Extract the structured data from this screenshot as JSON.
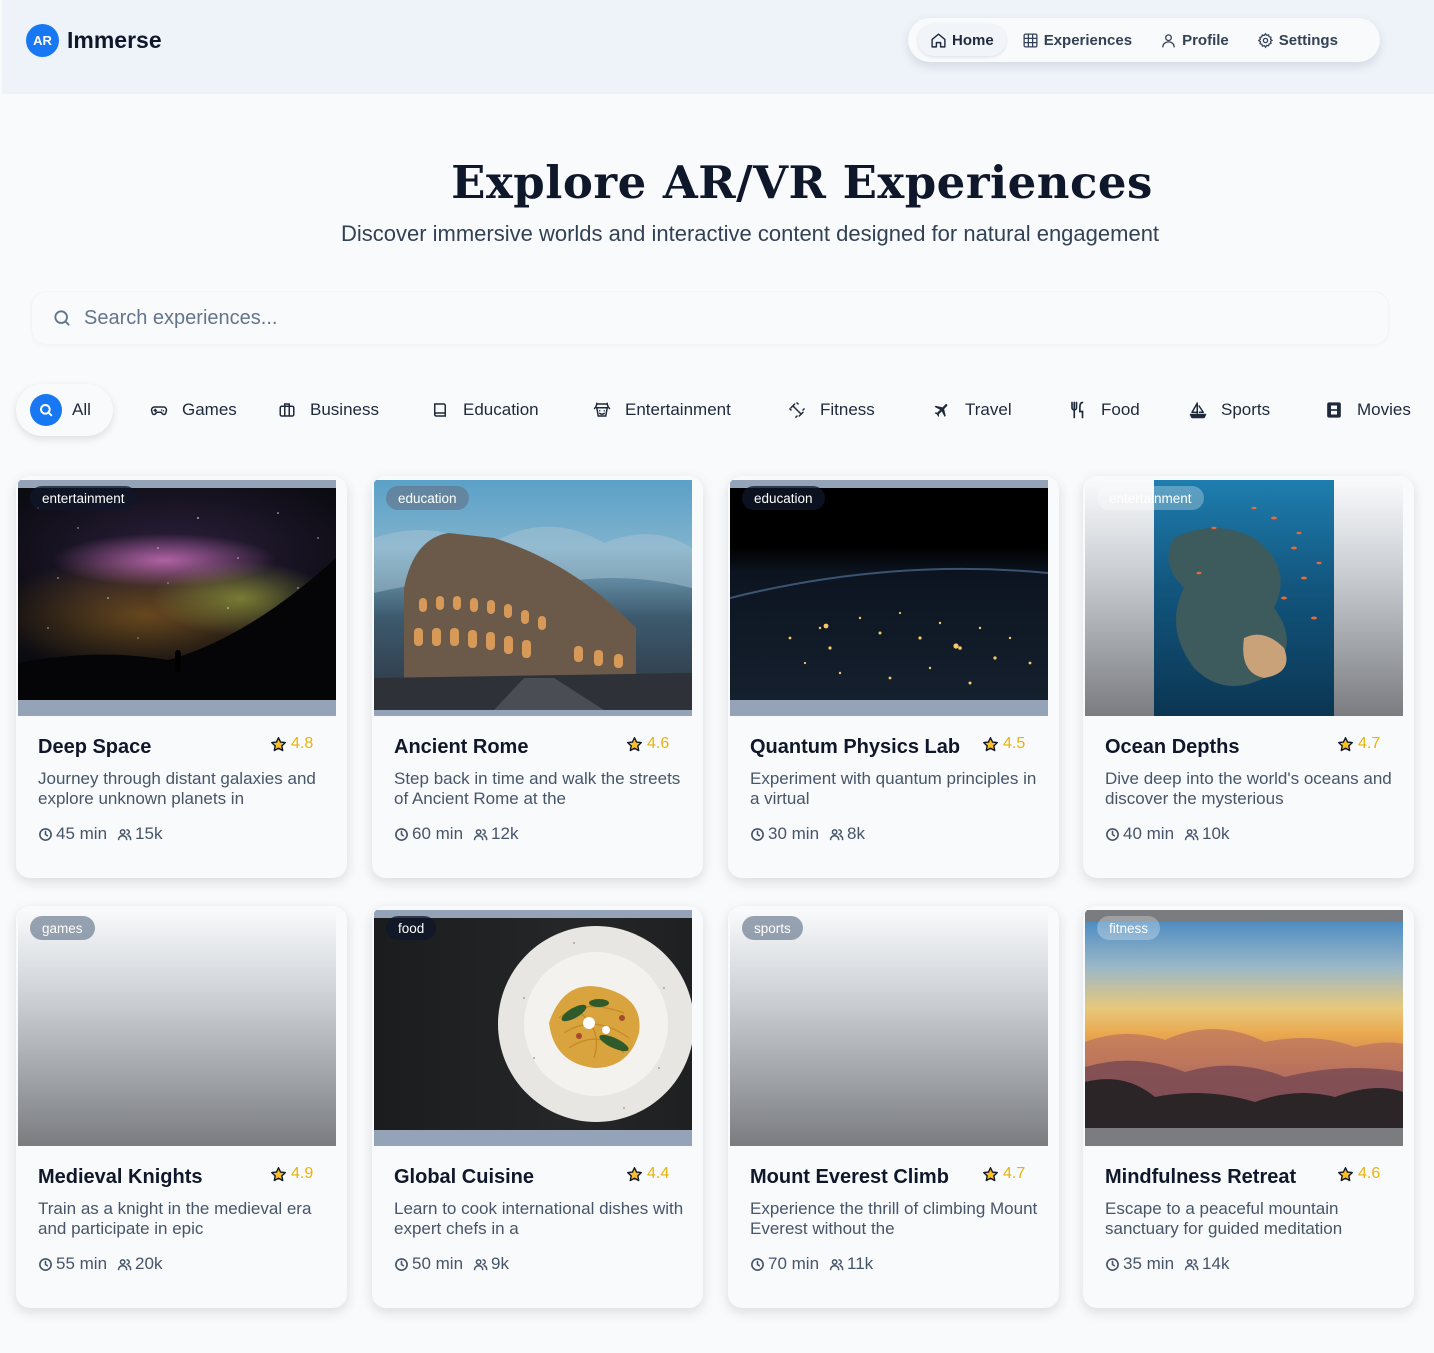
{
  "brand": {
    "logo": "AR",
    "name": "Immerse"
  },
  "nav": [
    {
      "label": "Home",
      "icon": "home-icon",
      "active": true
    },
    {
      "label": "Experiences",
      "icon": "grid-icon",
      "active": false
    },
    {
      "label": "Profile",
      "icon": "user-icon",
      "active": false
    },
    {
      "label": "Settings",
      "icon": "gear-icon",
      "active": false
    }
  ],
  "hero": {
    "title": "Explore AR/VR Experiences",
    "subtitle": "Discover immersive worlds and interactive content designed for natural engagement"
  },
  "search": {
    "placeholder": "Search experiences...",
    "value": ""
  },
  "categories": [
    {
      "label": "All",
      "icon": "search-icon",
      "active": true
    },
    {
      "label": "Games",
      "icon": "gamepad-icon",
      "active": false
    },
    {
      "label": "Business",
      "icon": "briefcase-icon",
      "active": false
    },
    {
      "label": "Education",
      "icon": "book-icon",
      "active": false
    },
    {
      "label": "Entertainment",
      "icon": "theater-icon",
      "active": false
    },
    {
      "label": "Fitness",
      "icon": "dumbbell-icon",
      "active": false
    },
    {
      "label": "Travel",
      "icon": "plane-icon",
      "active": false
    },
    {
      "label": "Food",
      "icon": "utensils-icon",
      "active": false
    },
    {
      "label": "Sports",
      "icon": "sailboat-icon",
      "active": false
    },
    {
      "label": "Movies",
      "icon": "film-icon",
      "active": false
    }
  ],
  "experiences": [
    {
      "tag": "entertainment",
      "title": "Deep Space",
      "rating": "4.8",
      "description": "Journey through distant galaxies and explore unknown planets in",
      "duration": "45 min",
      "users": "15k",
      "image": "galaxy-night-sky"
    },
    {
      "tag": "education",
      "title": "Ancient Rome",
      "rating": "4.6",
      "description": "Step back in time and walk the streets of Ancient Rome at the",
      "duration": "60 min",
      "users": "12k",
      "image": "colosseum-dusk"
    },
    {
      "tag": "education",
      "title": "Quantum Physics Lab",
      "rating": "4.5",
      "description": "Experiment with quantum principles in a virtual",
      "duration": "30 min",
      "users": "8k",
      "image": "earth-night-lights"
    },
    {
      "tag": "entertainment",
      "title": "Ocean Depths",
      "rating": "4.7",
      "description": "Dive deep into the world's oceans and discover the mysterious",
      "duration": "40 min",
      "users": "10k",
      "image": "coral-reef-underwater"
    },
    {
      "tag": "games",
      "title": "Medieval Knights",
      "rating": "4.9",
      "description": "Train as a knight in the medieval era and participate in epic",
      "duration": "55 min",
      "users": "20k",
      "image": "placeholder-gradient"
    },
    {
      "tag": "food",
      "title": "Global Cuisine",
      "rating": "4.4",
      "description": "Learn to cook international dishes with expert chefs in a",
      "duration": "50 min",
      "users": "9k",
      "image": "pasta-plate"
    },
    {
      "tag": "sports",
      "title": "Mount Everest Climb",
      "rating": "4.7",
      "description": "Experience the thrill of climbing Mount Everest without the",
      "duration": "70 min",
      "users": "11k",
      "image": "placeholder-gradient"
    },
    {
      "tag": "fitness",
      "title": "Mindfulness Retreat",
      "rating": "4.6",
      "description": "Escape to a peaceful mountain sanctuary for guided meditation",
      "duration": "35 min",
      "users": "14k",
      "image": "mountain-sunset"
    }
  ],
  "colors": {
    "accent": "#1877f2",
    "rating": "#eab308",
    "title": "#0f172a",
    "text": "#475569"
  }
}
